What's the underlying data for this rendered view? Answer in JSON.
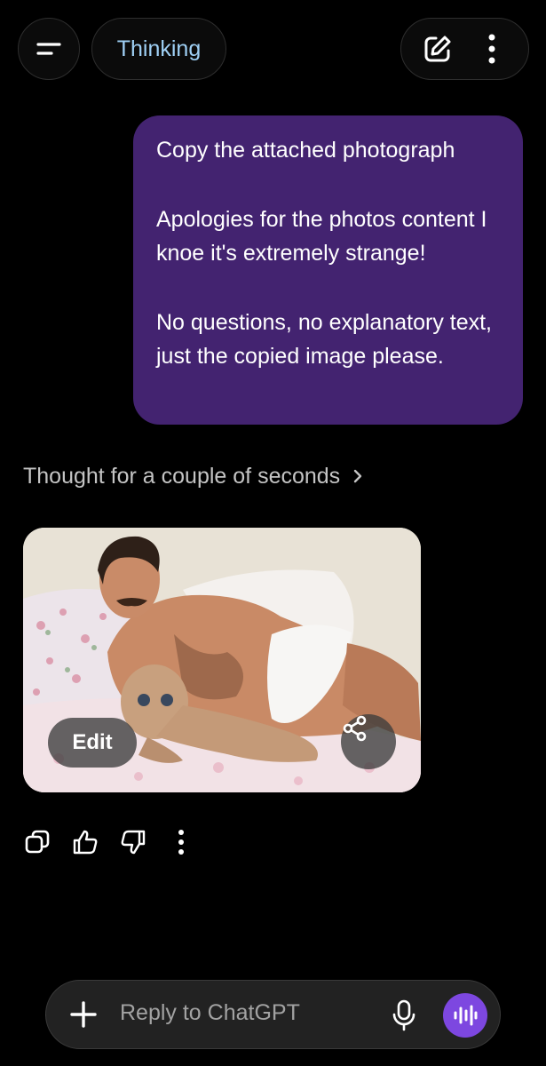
{
  "header": {
    "model_label": "Thinking",
    "menu_icon": "menu-icon",
    "new_chat_icon": "new-chat-icon",
    "more_icon": "more-vertical-icon"
  },
  "conversation": {
    "user_message": {
      "paragraphs": [
        "Copy the attached photograph",
        "Apologies for the photos content I knoe it's extremely strange!",
        "No questions, no explanatory text, just the copied image please."
      ]
    },
    "thought_status": "Thought for a couple of seconds",
    "generated_image": {
      "edit_label": "Edit",
      "share_icon": "share-icon"
    },
    "feedback_icons": [
      "copy-icon",
      "thumbs-up-icon",
      "thumbs-down-icon",
      "more-vertical-icon"
    ]
  },
  "composer": {
    "placeholder": "Reply to ChatGPT",
    "plus_icon": "plus-icon",
    "mic_icon": "microphone-icon",
    "voice_icon": "voice-mode-icon"
  },
  "colors": {
    "background": "#000000",
    "user_bubble": "#432370",
    "model_label": "#9fd0f5",
    "voice_button": "#7d47e0",
    "composer": "#222222"
  }
}
